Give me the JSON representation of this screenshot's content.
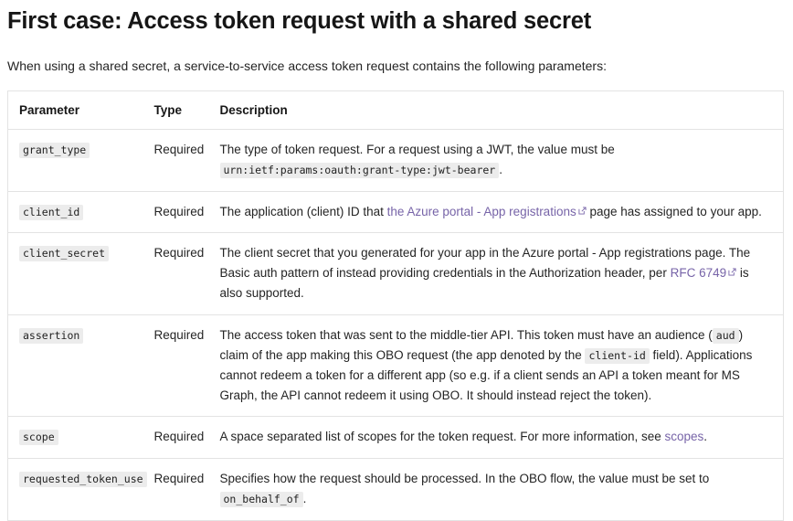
{
  "page": {
    "title": "First case: Access token request with a shared secret",
    "intro": "When using a shared secret, a service-to-service access token request contains the following parameters:"
  },
  "colors": {
    "link": "#7764a8",
    "code_background": "#ececec",
    "table_border": "#e3e3e3",
    "text": "#242424",
    "heading": "#161616"
  },
  "table": {
    "headers": {
      "parameter": "Parameter",
      "type": "Type",
      "description": "Description"
    },
    "rows": [
      {
        "parameter": "grant_type",
        "type": "Required",
        "description": {
          "part1": "The type of token request. For a request using a JWT, the value must be ",
          "code1": "urn:ietf:params:oauth:grant-type:jwt-bearer",
          "part2": "."
        }
      },
      {
        "parameter": "client_id",
        "type": "Required",
        "description": {
          "part1": "The application (client) ID that ",
          "link1": "the Azure portal - App registrations",
          "link1_icon": "external-link-icon",
          "part2": " page has assigned to your app."
        }
      },
      {
        "parameter": "client_secret",
        "type": "Required",
        "description": {
          "part1": "The client secret that you generated for your app in the Azure portal - App registrations page. The Basic auth pattern of instead providing credentials in the Authorization header, per ",
          "link1": "RFC 6749",
          "link1_icon": "external-link-icon",
          "part2": " is also supported."
        }
      },
      {
        "parameter": "assertion",
        "type": "Required",
        "description": {
          "part1": "The access token that was sent to the middle-tier API. This token must have an audience (",
          "code1": "aud",
          "part2": ") claim of the app making this OBO request (the app denoted by the ",
          "code2": "client-id",
          "part3": " field). Applications cannot redeem a token for a different app (so e.g. if a client sends an API a token meant for MS Graph, the API cannot redeem it using OBO. It should instead reject the token)."
        }
      },
      {
        "parameter": "scope",
        "type": "Required",
        "description": {
          "part1": "A space separated list of scopes for the token request. For more information, see ",
          "link1": "scopes",
          "part2": "."
        }
      },
      {
        "parameter": "requested_token_use",
        "type": "Required",
        "description": {
          "part1": "Specifies how the request should be processed. In the OBO flow, the value must be set to ",
          "code1": "on_behalf_of",
          "part2": "."
        }
      }
    ]
  }
}
